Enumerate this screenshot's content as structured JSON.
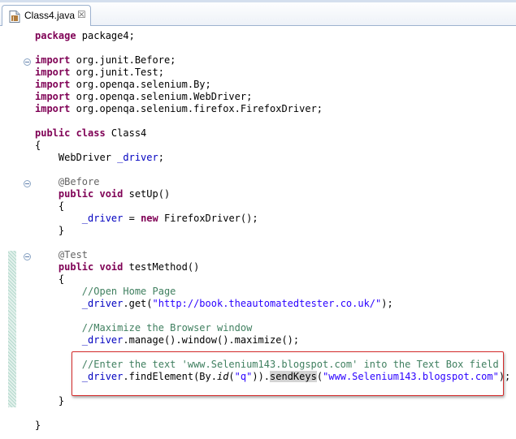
{
  "tab": {
    "title": "Class4.java",
    "icon": "java-file-icon",
    "close_glyph": "☒"
  },
  "code": {
    "package_kw": "package",
    "package_name": " package4;",
    "imports": [
      {
        "kw": "import",
        "name": " org.junit.Before;"
      },
      {
        "kw": "import",
        "name": " org.junit.Test;"
      },
      {
        "kw": "import",
        "name": " org.openqa.selenium.By;"
      },
      {
        "kw": "import",
        "name": " org.openqa.selenium.WebDriver;"
      },
      {
        "kw": "import",
        "name": " org.openqa.selenium.firefox.FirefoxDriver;"
      }
    ],
    "class_kw": "public class",
    "class_name": " Class4",
    "open_brace": "{",
    "close_brace": "}",
    "field_type": "    WebDriver ",
    "field_name": "_driver",
    "semicolon": ";",
    "before_ann": "    @Before",
    "setup_kw": "    public void",
    "setup_name": " setUp()",
    "inner_open": "    {",
    "inner_close": "    }",
    "setup_indent": "        ",
    "setup_assign": " = ",
    "new_kw": "new",
    "setup_rest": " FirefoxDriver();",
    "test_ann": "    @Test",
    "test_kw": "    public void",
    "test_name": " testMethod()",
    "body_indent": "        ",
    "comment1": "//Open Home Page",
    "get_call": ".get(",
    "url": "\"http://book.theautomatedtester.co.uk/\"",
    "get_end": ");",
    "comment2": "//Maximize the Browser window",
    "maximize_call": ".manage().window().maximize();",
    "comment3": "//Enter the text 'www.Selenium143.blogspot.com' into the Text Box field",
    "find_call": ".findElement(By.",
    "id_method": "id",
    "id_arg_open": "(",
    "id_value": "\"q\"",
    "find_end": ")).",
    "send_keys": "sendKeys",
    "send_open": "(",
    "send_value": "\"www.Selenium143.blogspot.com\"",
    "send_end": ");"
  },
  "colors": {
    "keyword": "#7f0055",
    "annotation": "#646464",
    "field": "#0000c0",
    "comment": "#3f7f5f",
    "string": "#2a00ff",
    "highlight_border": "#d42a2a"
  }
}
